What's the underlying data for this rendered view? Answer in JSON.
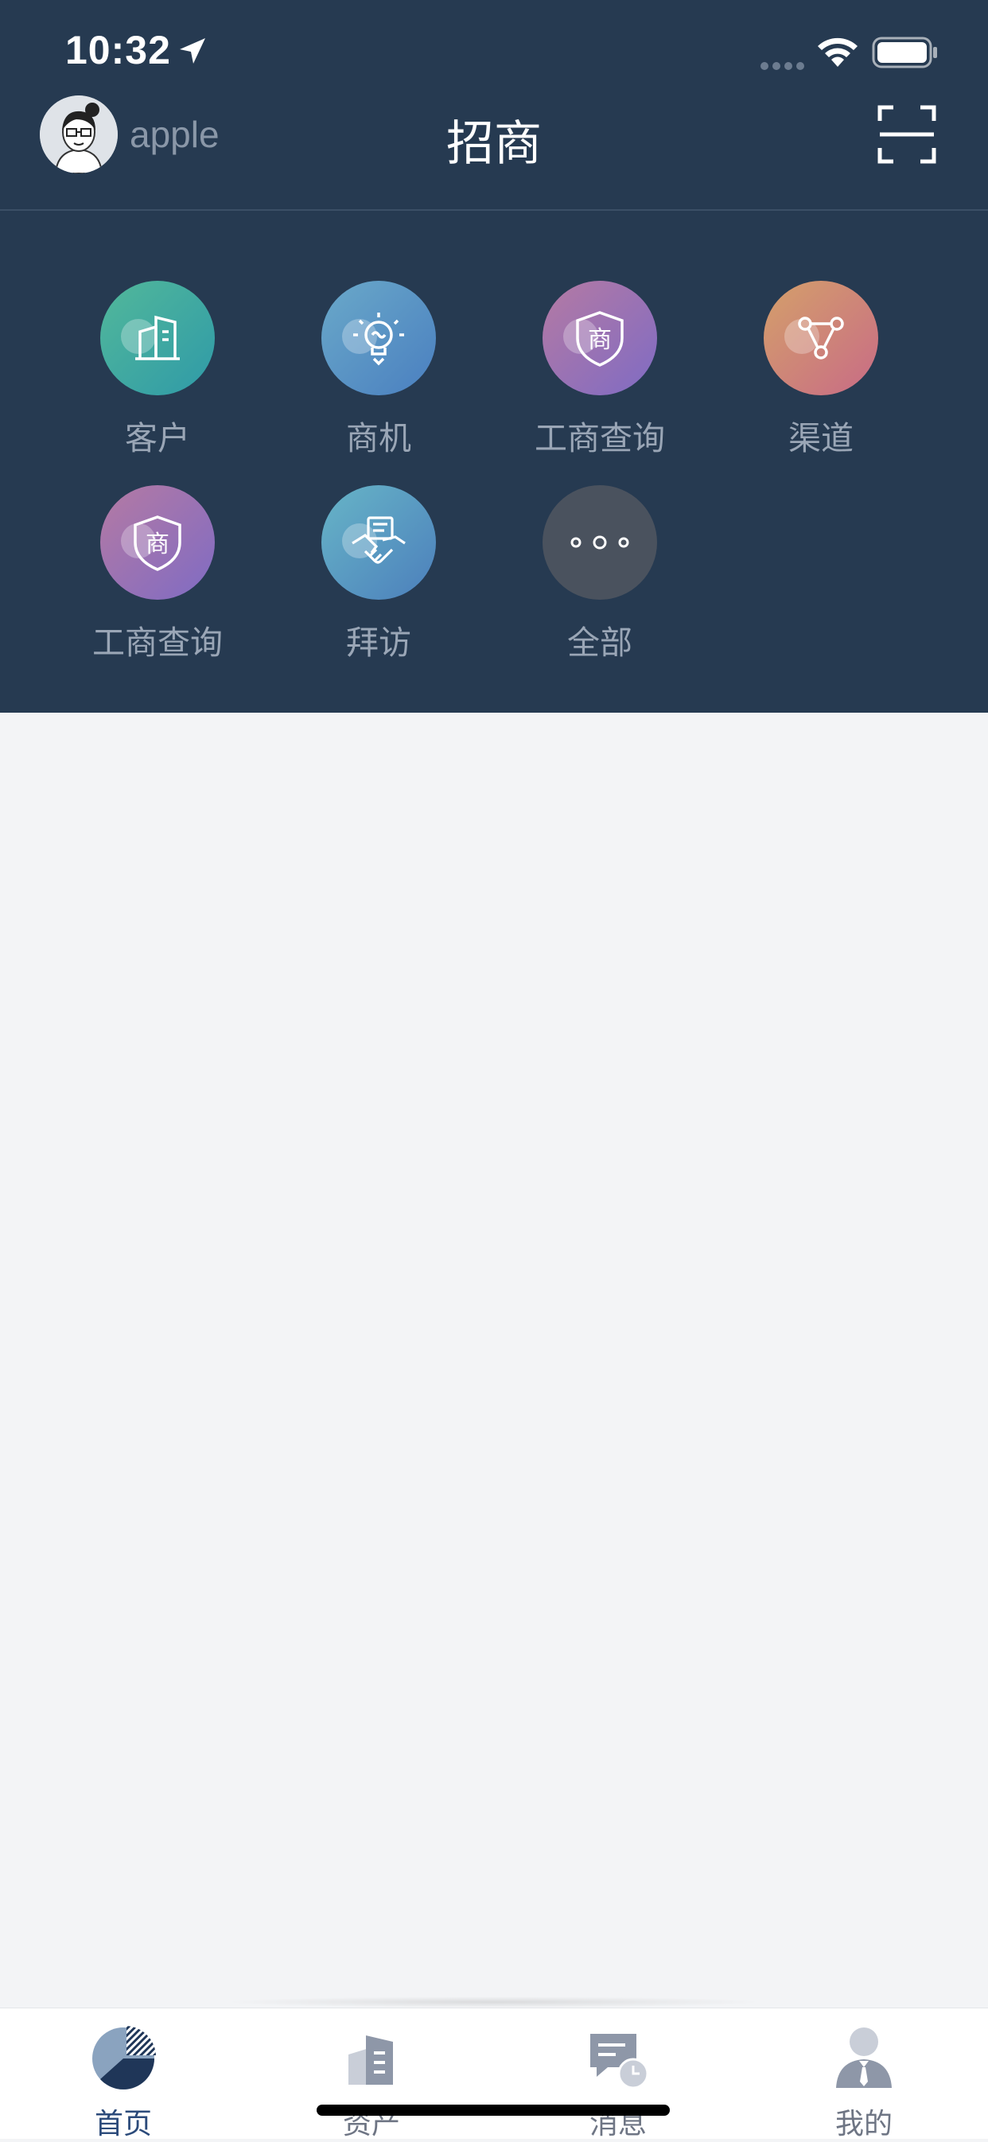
{
  "status_bar": {
    "time": "10:32"
  },
  "header": {
    "username": "apple",
    "title": "招商"
  },
  "shortcuts": [
    {
      "label": "客户",
      "icon": "building-icon"
    },
    {
      "label": "商机",
      "icon": "lightbulb-icon"
    },
    {
      "label": "工商查询",
      "icon": "shield-shang-icon"
    },
    {
      "label": "渠道",
      "icon": "channel-nodes-icon"
    },
    {
      "label": "工商查询",
      "icon": "shield-shang-icon"
    },
    {
      "label": "拜访",
      "icon": "handshake-icon"
    },
    {
      "label": "全部",
      "icon": "more-dots-icon"
    }
  ],
  "tabbar": {
    "items": [
      {
        "label": "首页",
        "icon": "pie-chart-icon",
        "active": true
      },
      {
        "label": "资产",
        "icon": "assets-icon",
        "active": false
      },
      {
        "label": "消息",
        "icon": "message-clock-icon",
        "active": false
      },
      {
        "label": "我的",
        "icon": "person-icon",
        "active": false
      }
    ]
  },
  "colors": {
    "header_bg": "#263a51",
    "page_bg": "#f3f4f6",
    "active_tab": "#2b4a7a"
  }
}
